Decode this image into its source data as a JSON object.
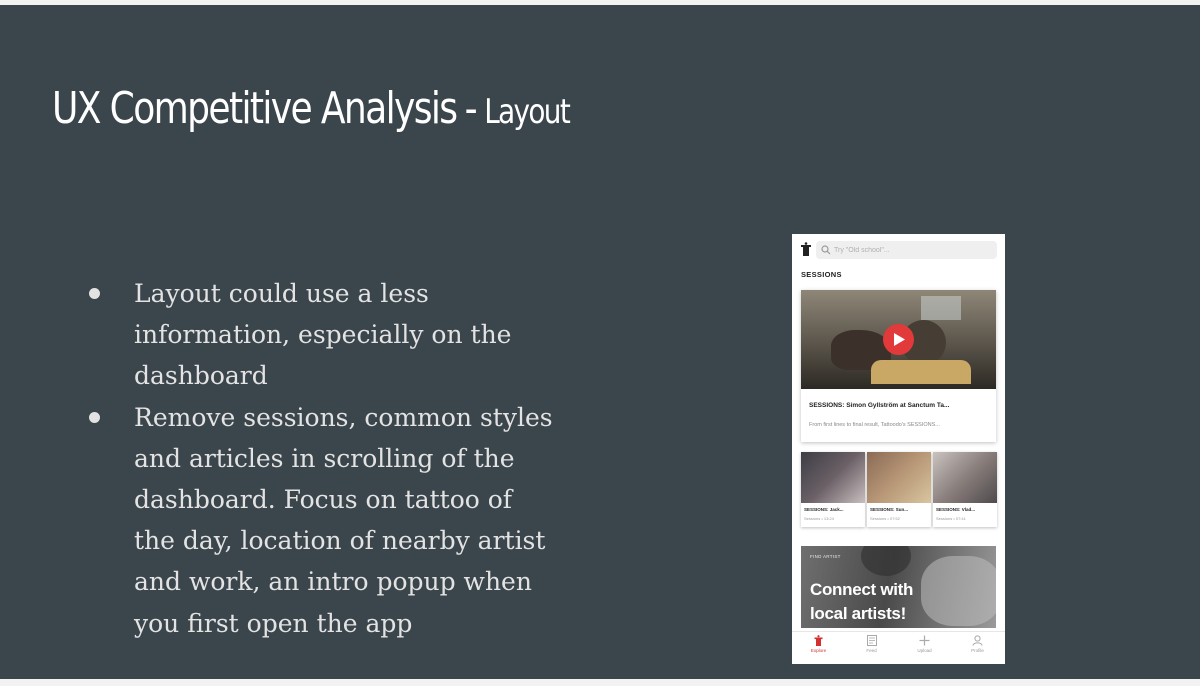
{
  "slide": {
    "title_main": "UX Competitive Analysis",
    "title_separator": "-",
    "title_sub": "Layout",
    "bullets": [
      "Layout could use a less information, especially on the dashboard",
      "Remove sessions, common styles and articles in scrolling of the dashboard. Focus on tattoo of the day, location of nearby artist and work, an intro popup when you first open the app"
    ]
  },
  "phone": {
    "search_placeholder": "Try \"Old school\"...",
    "sessions_heading": "SESSIONS",
    "featured": {
      "title": "SESSIONS: Simon Gyllström at Sanctum Ta...",
      "description": "From first lines to final result, Tattoodo's SESSIONS..."
    },
    "mini_cards": [
      {
        "title": "SESSIONS: Jack...",
        "meta": "Sessions • 13:24"
      },
      {
        "title": "SESSIONS: Sun...",
        "meta": "Sessions • 07:52"
      },
      {
        "title": "SESSIONS: Vlad...",
        "meta": "Sessions • 07:41"
      }
    ],
    "promo": {
      "kicker": "FIND ARTIST",
      "line1": "Connect with",
      "line2": "local artists!"
    },
    "tabs": [
      {
        "label": "Explore",
        "icon": "explore-icon"
      },
      {
        "label": "Feed",
        "icon": "feed-icon"
      },
      {
        "label": "Upload",
        "icon": "plus-icon"
      },
      {
        "label": "Profile",
        "icon": "profile-icon"
      }
    ],
    "colors": {
      "accent": "#d23131",
      "slide_background": "#3a454c"
    }
  }
}
